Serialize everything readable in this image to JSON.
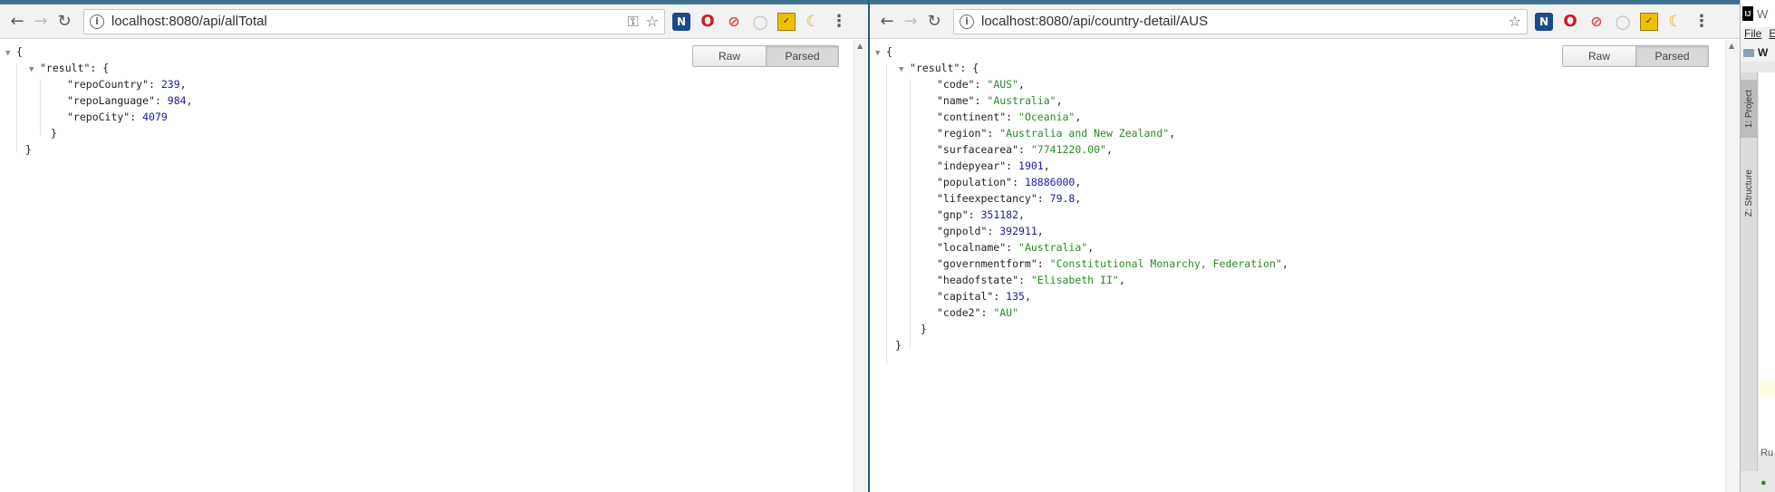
{
  "left_window": {
    "url": "localhost:8080/api/allTotal",
    "toggle": {
      "raw": "Raw",
      "parsed": "Parsed"
    },
    "json": {
      "open": "{",
      "result_key": "\"result\"",
      "result_open": ": {",
      "entries": [
        {
          "key": "\"repoCountry\"",
          "value": "239",
          "type": "num",
          "comma": true
        },
        {
          "key": "\"repoLanguage\"",
          "value": "984",
          "type": "num",
          "comma": true
        },
        {
          "key": "\"repoCity\"",
          "value": "4079",
          "type": "num",
          "comma": false
        }
      ],
      "inner_close": "}",
      "close": "}"
    }
  },
  "right_window": {
    "url": "localhost:8080/api/country-detail/AUS",
    "toggle": {
      "raw": "Raw",
      "parsed": "Parsed"
    },
    "json": {
      "open": "{",
      "result_key": "\"result\"",
      "result_open": ": {",
      "entries": [
        {
          "key": "\"code\"",
          "value": "\"AUS\"",
          "type": "str",
          "comma": true
        },
        {
          "key": "\"name\"",
          "value": "\"Australia\"",
          "type": "str",
          "comma": true
        },
        {
          "key": "\"continent\"",
          "value": "\"Oceania\"",
          "type": "str",
          "comma": true
        },
        {
          "key": "\"region\"",
          "value": "\"Australia and New Zealand\"",
          "type": "str",
          "comma": true
        },
        {
          "key": "\"surfacearea\"",
          "value": "\"7741220.00\"",
          "type": "str",
          "comma": true
        },
        {
          "key": "\"indepyear\"",
          "value": "1901",
          "type": "num",
          "comma": true
        },
        {
          "key": "\"population\"",
          "value": "18886000",
          "type": "num",
          "comma": true
        },
        {
          "key": "\"lifeexpectancy\"",
          "value": "79.8",
          "type": "num",
          "comma": true
        },
        {
          "key": "\"gnp\"",
          "value": "351182",
          "type": "num",
          "comma": true
        },
        {
          "key": "\"gnpold\"",
          "value": "392911",
          "type": "num",
          "comma": true
        },
        {
          "key": "\"localname\"",
          "value": "\"Australia\"",
          "type": "str",
          "comma": true
        },
        {
          "key": "\"governmentform\"",
          "value": "\"Constitutional Monarchy, Federation\"",
          "type": "str",
          "comma": true
        },
        {
          "key": "\"headofstate\"",
          "value": "\"Elisabeth II\"",
          "type": "str",
          "comma": true
        },
        {
          "key": "\"capital\"",
          "value": "135",
          "type": "num",
          "comma": true
        },
        {
          "key": "\"code2\"",
          "value": "\"AU\"",
          "type": "str",
          "comma": false
        }
      ],
      "inner_close": "}",
      "close": "}"
    }
  },
  "ide_panel": {
    "title_fragment": "W",
    "menu_fragment": "File",
    "menu_fragment2": "E",
    "project_crumb": "W",
    "side_tabs": [
      "1: Project",
      "Z: Structure"
    ],
    "bottom_fragment": "Ru"
  },
  "icons": {
    "back": "arrow-left-icon",
    "forward": "arrow-right-icon",
    "reload": "reload-icon",
    "info": "info-icon",
    "key": "key-icon",
    "star": "star-icon",
    "menu": "kebab-menu-icon"
  },
  "colors": {
    "json_number": "#1a1aa6",
    "json_string": "#2a8a2a",
    "tabstrip": "#3f6e8e"
  }
}
